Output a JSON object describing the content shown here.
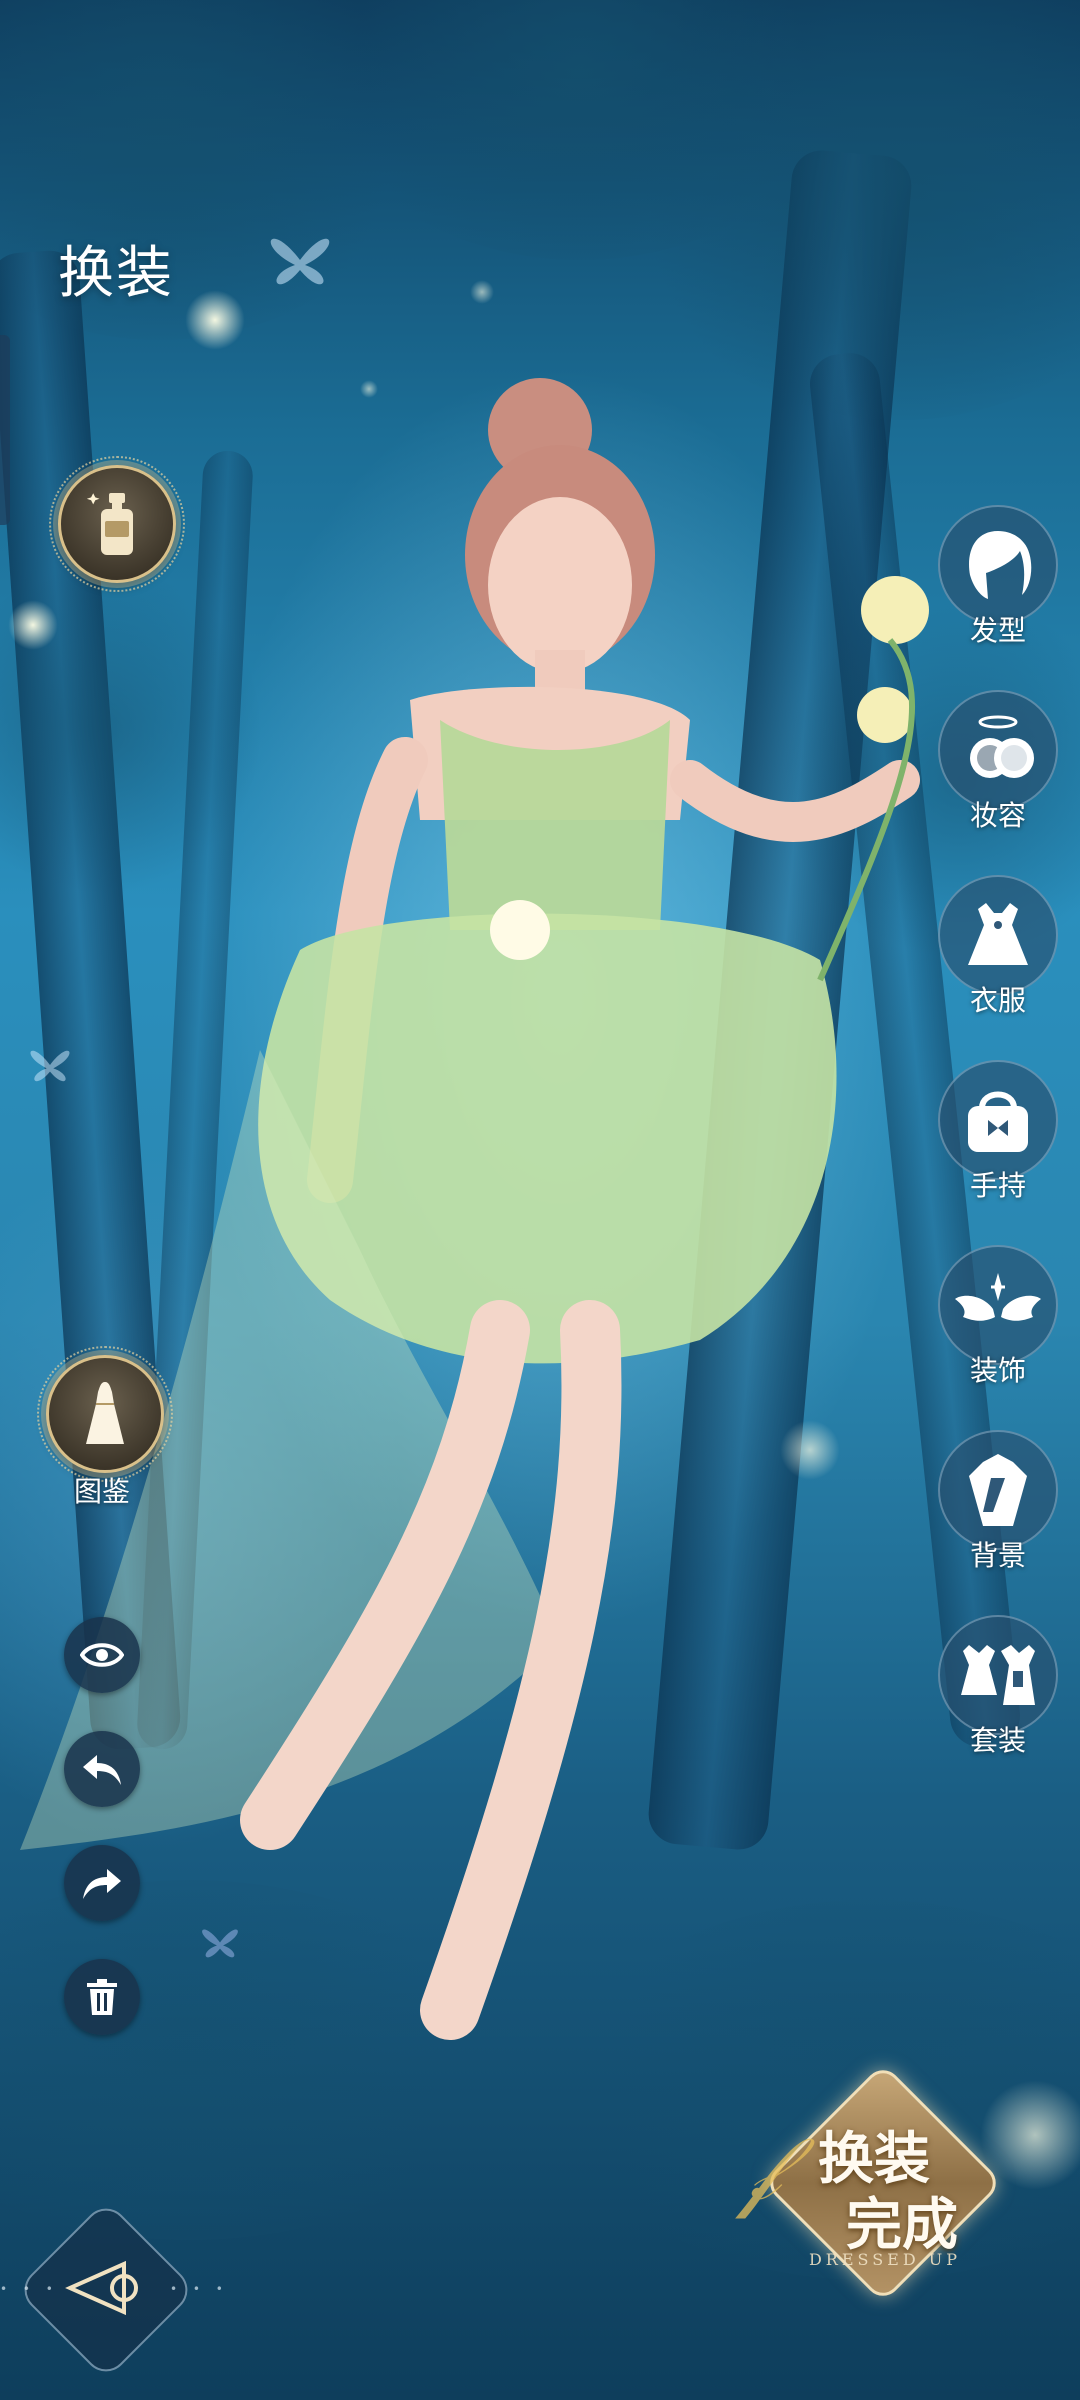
{
  "screen": {
    "title": "换装"
  },
  "left_panel": {
    "cosmetic_button": {
      "icon": "perfume-bottle-icon"
    },
    "gallery_button": {
      "icon": "dress-icon",
      "label": "图鉴"
    },
    "tools": [
      {
        "icon": "eye-icon"
      },
      {
        "icon": "undo-icon"
      },
      {
        "icon": "redo-icon"
      },
      {
        "icon": "trash-icon"
      }
    ]
  },
  "categories": [
    {
      "label": "发型",
      "icon": "hair-icon"
    },
    {
      "label": "妆容",
      "icon": "makeup-icon"
    },
    {
      "label": "衣服",
      "icon": "dress-icon"
    },
    {
      "label": "手持",
      "icon": "handbag-icon"
    },
    {
      "label": "装饰",
      "icon": "wings-icon"
    },
    {
      "label": "背景",
      "icon": "background-icon"
    },
    {
      "label": "套装",
      "icon": "outfit-set-icon"
    }
  ],
  "done_button": {
    "line1": "换装",
    "line2": "完成",
    "subtitle": "DRESSED UP"
  },
  "colors": {
    "gold": "#d9c08a",
    "panel_dark": "#19324b",
    "accent_green": "#a9d88a"
  }
}
